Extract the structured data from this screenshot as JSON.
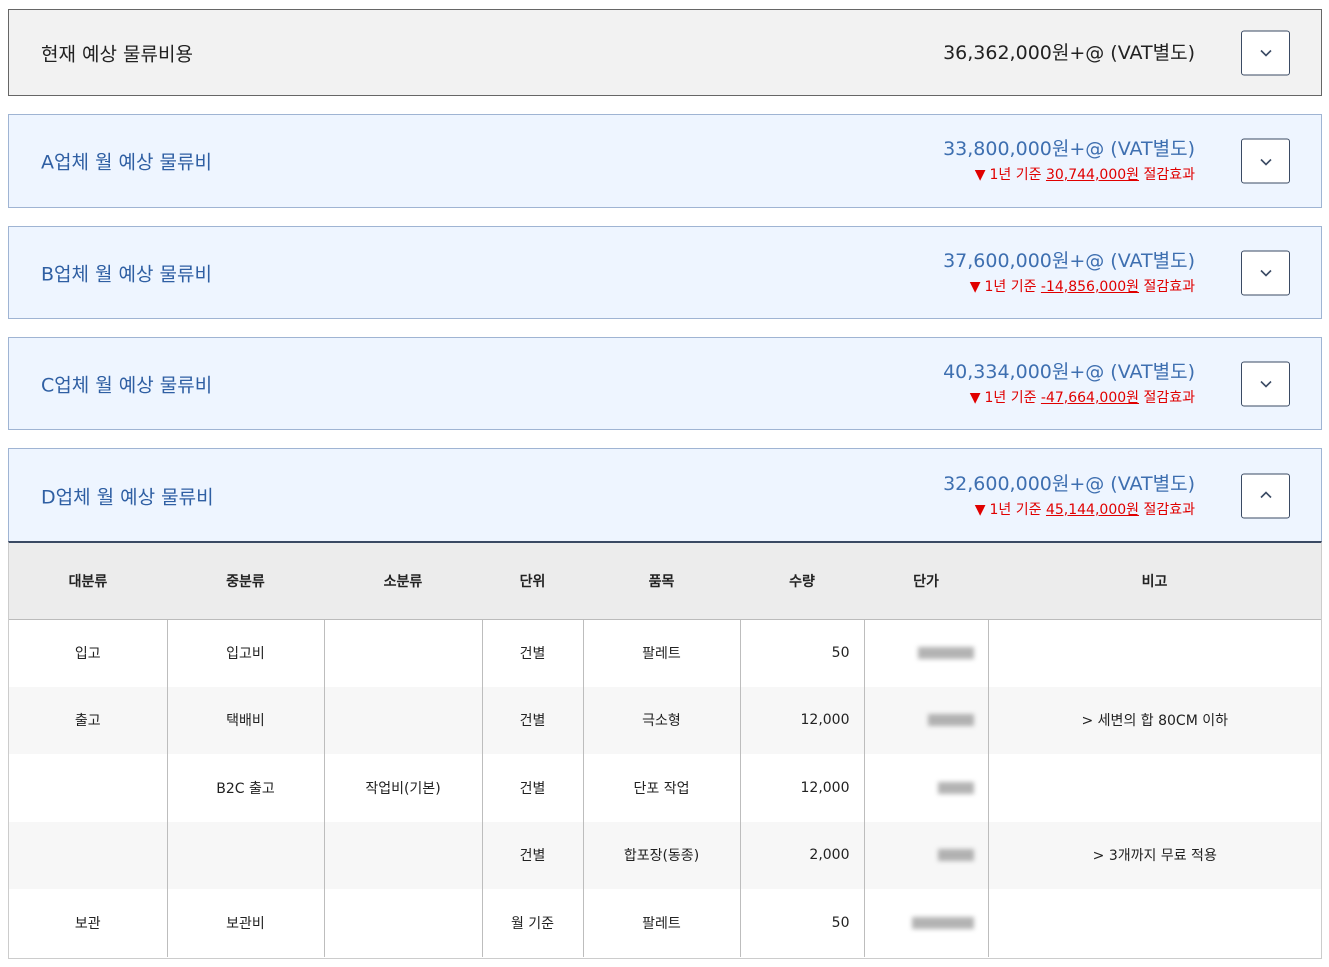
{
  "current": {
    "title": "현재 예상 물류비용",
    "amount": "36,362,000원+@ (VAT별도)"
  },
  "vendors": [
    {
      "title": "A업체 월 예상 물류비",
      "amount": "33,800,000원+@ (VAT별도)",
      "saving_prefix": "1년 기준 ",
      "saving_value": "30,744,000원",
      "saving_suffix": " 절감효과",
      "expanded": false
    },
    {
      "title": "B업체 월 예상 물류비",
      "amount": "37,600,000원+@ (VAT별도)",
      "saving_prefix": "1년 기준 ",
      "saving_value": "-14,856,000원",
      "saving_suffix": " 절감효과",
      "expanded": false
    },
    {
      "title": "C업체 월 예상 물류비",
      "amount": "40,334,000원+@ (VAT별도)",
      "saving_prefix": "1년 기준 ",
      "saving_value": "-47,664,000원",
      "saving_suffix": " 절감효과",
      "expanded": false
    },
    {
      "title": "D업체 월 예상 물류비",
      "amount": "32,600,000원+@ (VAT별도)",
      "saving_prefix": "1년 기준 ",
      "saving_value": "45,144,000원",
      "saving_suffix": " 절감효과",
      "expanded": true
    }
  ],
  "table": {
    "headers": [
      "대분류",
      "중분류",
      "소분류",
      "단위",
      "품목",
      "수량",
      "단가",
      "비고"
    ],
    "rows": [
      {
        "major": "입고",
        "middle": "입고비",
        "minor": "",
        "unit": "건별",
        "item": "팔레트",
        "qty": "50",
        "note": ""
      },
      {
        "major": "출고",
        "middle": "택배비",
        "minor": "",
        "unit": "건별",
        "item": "극소형",
        "qty": "12,000",
        "note": "> 세변의 합 80CM 이하"
      },
      {
        "major": "",
        "middle": "B2C 출고",
        "minor": "작업비(기본)",
        "unit": "건별",
        "item": "단포 작업",
        "qty": "12,000",
        "note": ""
      },
      {
        "major": "",
        "middle": "",
        "minor": "",
        "unit": "건별",
        "item": "합포장(동종)",
        "qty": "2,000",
        "note": "> 3개까지 무료 적용"
      },
      {
        "major": "보관",
        "middle": "보관비",
        "minor": "",
        "unit": "월 기준",
        "item": "팔레트",
        "qty": "50",
        "note": ""
      }
    ]
  },
  "icons": {
    "collapsed": "chevron-down-icon",
    "expanded": "chevron-up-icon"
  },
  "colors": {
    "accent": "#3e6fb0",
    "saving": "#e00000",
    "border_dark": "#3a4a63"
  }
}
